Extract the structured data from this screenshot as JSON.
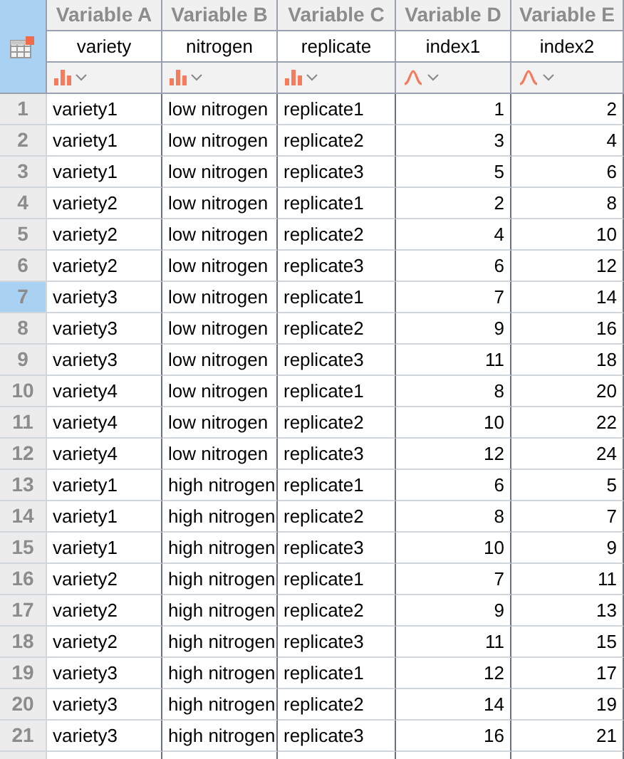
{
  "columns": [
    {
      "header": "Variable A",
      "name": "variety",
      "kind": "categorical"
    },
    {
      "header": "Variable B",
      "name": "nitrogen",
      "kind": "categorical"
    },
    {
      "header": "Variable C",
      "name": "replicate",
      "kind": "categorical"
    },
    {
      "header": "Variable D",
      "name": "index1",
      "kind": "continuous"
    },
    {
      "header": "Variable E",
      "name": "index2",
      "kind": "continuous"
    }
  ],
  "rows": [
    {
      "number": "1",
      "selected": false,
      "cells": [
        "variety1",
        "low nitrogen",
        "replicate1",
        "1",
        "2"
      ]
    },
    {
      "number": "2",
      "selected": false,
      "cells": [
        "variety1",
        "low nitrogen",
        "replicate2",
        "3",
        "4"
      ]
    },
    {
      "number": "3",
      "selected": false,
      "cells": [
        "variety1",
        "low nitrogen",
        "replicate3",
        "5",
        "6"
      ]
    },
    {
      "number": "4",
      "selected": false,
      "cells": [
        "variety2",
        "low nitrogen",
        "replicate1",
        "2",
        "8"
      ]
    },
    {
      "number": "5",
      "selected": false,
      "cells": [
        "variety2",
        "low nitrogen",
        "replicate2",
        "4",
        "10"
      ]
    },
    {
      "number": "6",
      "selected": false,
      "cells": [
        "variety2",
        "low nitrogen",
        "replicate3",
        "6",
        "12"
      ]
    },
    {
      "number": "7",
      "selected": true,
      "cells": [
        "variety3",
        "low nitrogen",
        "replicate1",
        "7",
        "14"
      ]
    },
    {
      "number": "8",
      "selected": false,
      "cells": [
        "variety3",
        "low nitrogen",
        "replicate2",
        "9",
        "16"
      ]
    },
    {
      "number": "9",
      "selected": false,
      "cells": [
        "variety3",
        "low nitrogen",
        "replicate3",
        "11",
        "18"
      ]
    },
    {
      "number": "10",
      "selected": false,
      "cells": [
        "variety4",
        "low nitrogen",
        "replicate1",
        "8",
        "20"
      ]
    },
    {
      "number": "11",
      "selected": false,
      "cells": [
        "variety4",
        "low nitrogen",
        "replicate2",
        "10",
        "22"
      ]
    },
    {
      "number": "12",
      "selected": false,
      "cells": [
        "variety4",
        "low nitrogen",
        "replicate3",
        "12",
        "24"
      ]
    },
    {
      "number": "13",
      "selected": false,
      "cells": [
        "variety1",
        "high nitrogen",
        "replicate1",
        "6",
        "5"
      ]
    },
    {
      "number": "14",
      "selected": false,
      "cells": [
        "variety1",
        "high nitrogen",
        "replicate2",
        "8",
        "7"
      ]
    },
    {
      "number": "15",
      "selected": false,
      "cells": [
        "variety1",
        "high nitrogen",
        "replicate3",
        "10",
        "9"
      ]
    },
    {
      "number": "16",
      "selected": false,
      "cells": [
        "variety2",
        "high nitrogen",
        "replicate1",
        "7",
        "11"
      ]
    },
    {
      "number": "17",
      "selected": false,
      "cells": [
        "variety2",
        "high nitrogen",
        "replicate2",
        "9",
        "13"
      ]
    },
    {
      "number": "18",
      "selected": false,
      "cells": [
        "variety2",
        "high nitrogen",
        "replicate3",
        "11",
        "15"
      ]
    },
    {
      "number": "19",
      "selected": false,
      "cells": [
        "variety3",
        "high nitrogen",
        "replicate1",
        "12",
        "17"
      ]
    },
    {
      "number": "20",
      "selected": false,
      "cells": [
        "variety3",
        "high nitrogen",
        "replicate2",
        "14",
        "19"
      ]
    },
    {
      "number": "21",
      "selected": false,
      "cells": [
        "variety3",
        "high nitrogen",
        "replicate3",
        "16",
        "21"
      ]
    }
  ]
}
